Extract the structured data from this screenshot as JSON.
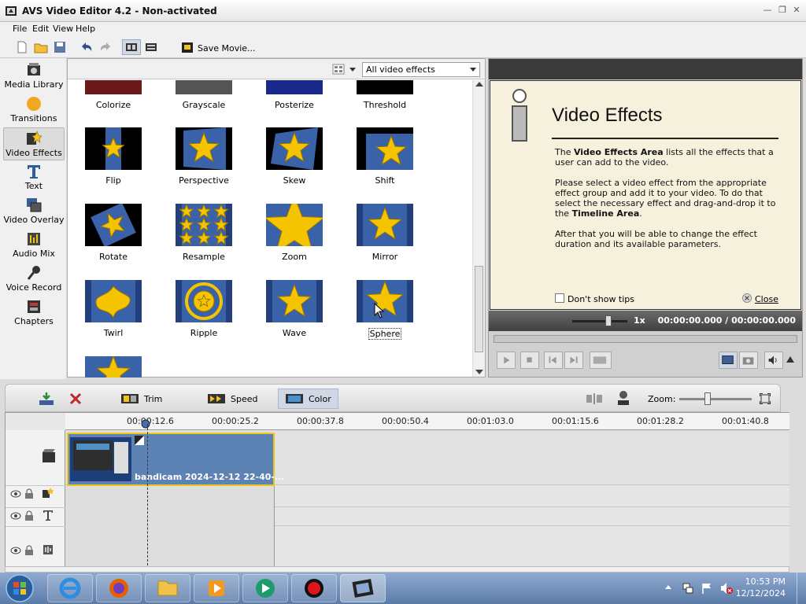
{
  "window": {
    "title": "AVS Video Editor 4.2 - Non-activated",
    "app_icon": "avs-logo-icon"
  },
  "menu": [
    "File",
    "Edit",
    "View",
    "Help"
  ],
  "toolbar": {
    "save_movie_label": "Save Movie..."
  },
  "nav": [
    {
      "label": "Media Library",
      "icon": "media-library-icon"
    },
    {
      "label": "Transitions",
      "icon": "transitions-icon"
    },
    {
      "label": "Video Effects",
      "icon": "video-effects-icon",
      "active": true
    },
    {
      "label": "Text",
      "icon": "text-icon"
    },
    {
      "label": "Video Overlay",
      "icon": "video-overlay-icon"
    },
    {
      "label": "Audio Mix",
      "icon": "audio-mix-icon"
    },
    {
      "label": "Voice Record",
      "icon": "voice-record-icon"
    },
    {
      "label": "Chapters",
      "icon": "chapters-icon"
    }
  ],
  "effects_filter": "All video effects",
  "effects": [
    {
      "name": "Colorize"
    },
    {
      "name": "Grayscale"
    },
    {
      "name": "Posterize"
    },
    {
      "name": "Threshold"
    },
    {
      "name": "Flip"
    },
    {
      "name": "Perspective"
    },
    {
      "name": "Skew"
    },
    {
      "name": "Shift"
    },
    {
      "name": "Rotate"
    },
    {
      "name": "Resample"
    },
    {
      "name": "Zoom"
    },
    {
      "name": "Mirror"
    },
    {
      "name": "Twirl"
    },
    {
      "name": "Ripple"
    },
    {
      "name": "Wave"
    },
    {
      "name": "Sphere",
      "selected": true
    },
    {
      "name": ""
    }
  ],
  "info": {
    "heading": "Video Effects",
    "p1_pre": "The ",
    "p1_bold": "Video Effects Area",
    "p1_post": " lists all the effects that a user can add to the video.",
    "p2_pre": "Please select a video effect from the appropriate effect group and add it to your video. To do that select the necessary effect and drag-and-drop it to the ",
    "p2_bold": "Timeline Area",
    "p2_post": ".",
    "p3": "After that you will be able to change the effect duration and its available parameters.",
    "dont_show": "Don't show tips",
    "close": "Close"
  },
  "player": {
    "speed": "1x",
    "time": "00:00:00.000 / 00:00:00.000"
  },
  "timeline_toolbar": {
    "trim": "Trim",
    "speed": "Speed",
    "color": "Color",
    "zoom": "Zoom:"
  },
  "ruler_ticks": [
    "00:00:12.6",
    "00:00:25.2",
    "00:00:37.8",
    "00:00:50.4",
    "00:01:03.0",
    "00:01:15.6",
    "00:01:28.2",
    "00:01:40.8"
  ],
  "clip": {
    "name": "bandicam 2024-12-12 22-40-..."
  },
  "clock": {
    "time": "10:53 PM",
    "date": "12/12/2024"
  }
}
